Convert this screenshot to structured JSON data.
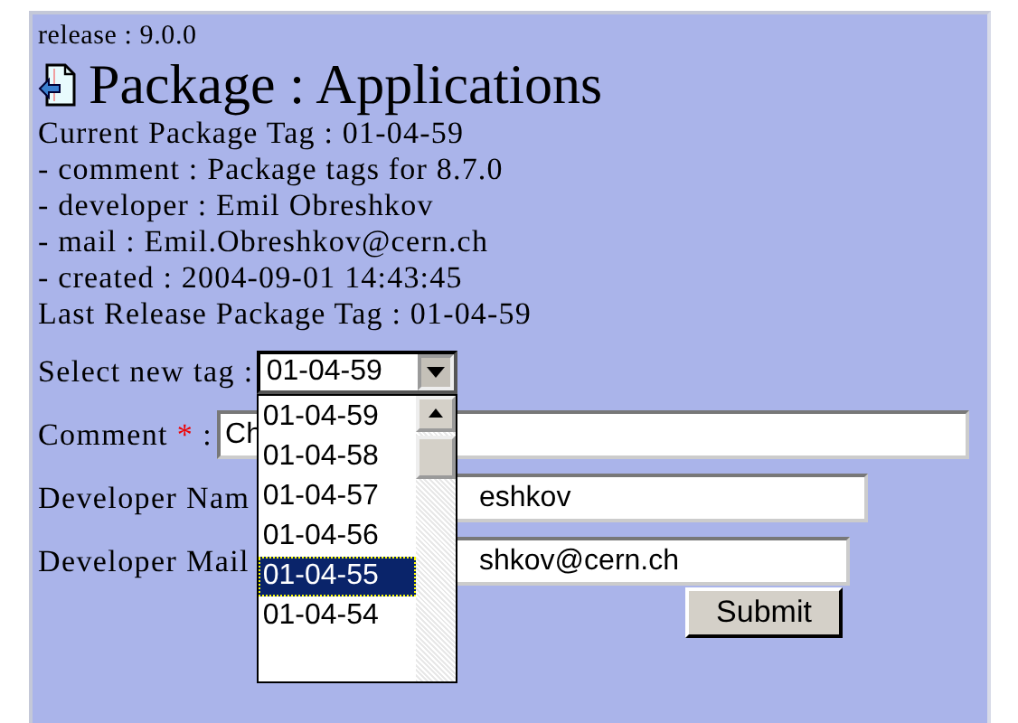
{
  "release": "release : 9.0.0",
  "title": "Package : Applications",
  "info_lines": [
    "Current Package Tag : 01-04-59",
    "- comment : Package tags for 8.7.0",
    "- developer : Emil Obreshkov",
    "- mail : Emil.Obreshkov@cern.ch",
    "- created : 2004-09-01 14:43:45",
    "Last Release Package Tag : 01-04-59"
  ],
  "form": {
    "select_label": "Select new tag :",
    "select_value": "01-04-59",
    "dropdown": {
      "expanded": true,
      "options": [
        {
          "label": "01-04-59",
          "selected": false
        },
        {
          "label": "01-04-58",
          "selected": false
        },
        {
          "label": "01-04-57",
          "selected": false
        },
        {
          "label": "01-04-56",
          "selected": false
        },
        {
          "label": "01-04-55",
          "selected": true
        },
        {
          "label": "01-04-54",
          "selected": false
        }
      ]
    },
    "comment": {
      "label": "Comment",
      "required_mark": "*",
      "suffix": ":",
      "value": "Ch"
    },
    "name": {
      "label": "Developer Nam",
      "value": "eshkov"
    },
    "mail": {
      "label": "Developer Mail",
      "value": "shkov@cern.ch"
    },
    "submit": "Submit"
  }
}
